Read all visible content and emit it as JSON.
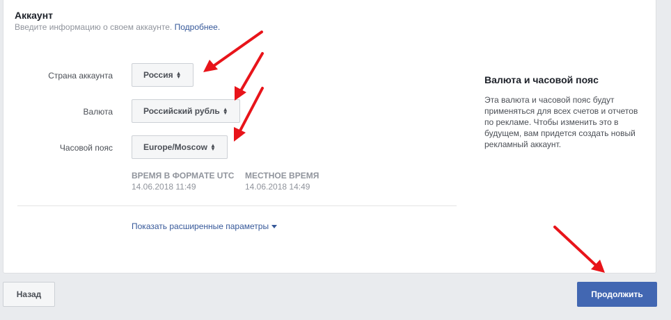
{
  "account": {
    "title": "Аккаунт",
    "subtitle": "Введите информацию о своем аккаунте.",
    "more_link": "Подробнее."
  },
  "form": {
    "country": {
      "label": "Страна аккаунта",
      "value": "Россия"
    },
    "currency": {
      "label": "Валюта",
      "value": "Российский рубль"
    },
    "timezone": {
      "label": "Часовой пояс",
      "value": "Europe/Moscow"
    },
    "utc_time": {
      "label": "ВРЕМЯ В ФОРМАТЕ UTC",
      "value": "14.06.2018 11:49"
    },
    "local_time": {
      "label": "МЕСТНОЕ ВРЕМЯ",
      "value": "14.06.2018 14:49"
    },
    "advanced_link": "Показать расширенные параметры"
  },
  "sidebar": {
    "title": "Валюта и часовой пояс",
    "text": "Эта валюта и часовой пояс будут применяться для всех счетов и отчетов по рекламе. Чтобы изменить это в будущем, вам придется создать новый рекламный аккаунт."
  },
  "footer": {
    "back_label": "Назад",
    "continue_label": "Продолжить"
  },
  "colors": {
    "primary": "#4267b2",
    "link": "#365899",
    "annotation_arrow": "#e8141a"
  }
}
